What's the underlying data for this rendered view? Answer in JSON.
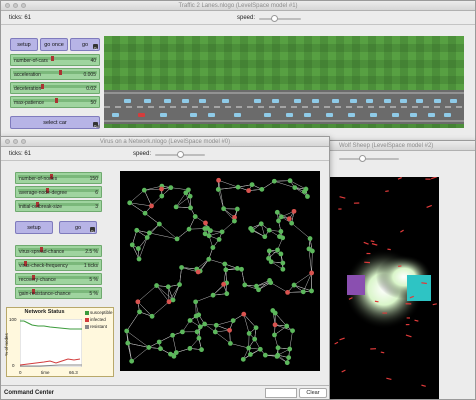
{
  "traffic": {
    "title": "Traffic 2 Lanes.nlogo (LevelSpace model #1)",
    "ticks_label": "ticks:",
    "ticks_value": "61",
    "speed_label": "speed:",
    "buttons": {
      "setup": "setup",
      "go_once": "go once",
      "go": "go",
      "select_car": "select car"
    },
    "sliders": [
      {
        "label": "number-of-cars",
        "value": "40",
        "frac": 0.45
      },
      {
        "label": "acceleration",
        "value": "0.005",
        "frac": 0.55
      },
      {
        "label": "deceleration",
        "value": "0.02",
        "frac": 0.35
      },
      {
        "label": "max-patience",
        "value": "50",
        "frac": 0.5
      }
    ]
  },
  "hidden_window_title": "Wolf Sheep (LevelSpace model #2)",
  "virus": {
    "title": "Virus on a Network.nlogo (LevelSpace model #0)",
    "ticks_label": "ticks:",
    "ticks_value": "61",
    "speed_label": "speed:",
    "sliders_top": [
      {
        "label": "number-of-nodes",
        "value": "150",
        "frac": 0.4
      },
      {
        "label": "average-node-degree",
        "value": "6",
        "frac": 0.35
      },
      {
        "label": "initial-outbreak-size",
        "value": "3",
        "frac": 0.25
      }
    ],
    "buttons": {
      "setup": "setup",
      "go": "go"
    },
    "sliders_bottom": [
      {
        "label": "virus-spread-chance",
        "value": "2.5 %",
        "frac": 0.3
      },
      {
        "label": "virus-check-frequency",
        "value": "1 ticks",
        "frac": 0.1
      },
      {
        "label": "recovery-chance",
        "value": "5 %",
        "frac": 0.2
      },
      {
        "label": "gain-resistance-chance",
        "value": "5 %",
        "frac": 0.2
      }
    ],
    "plot": {
      "title": "Network Status",
      "ylabel": "% of nodes",
      "xlabel": "time",
      "ymax": "100",
      "ymin": "0",
      "xmin": "0",
      "xmax": "66.3",
      "legend": [
        {
          "name": "susceptible",
          "color": "#3c9b3c"
        },
        {
          "name": "infected",
          "color": "#d23c3c"
        },
        {
          "name": "resistant",
          "color": "#888888"
        }
      ]
    },
    "command_center": "Command Center",
    "clear": "Clear"
  },
  "colors": {
    "grass": "#4c8f3a",
    "road": "#6b6b6b",
    "lane": "#dddddd",
    "button": "#b7b4e6",
    "slider": "#9fd49f",
    "node_green": "#5cb85c",
    "node_red": "#d9534f"
  }
}
